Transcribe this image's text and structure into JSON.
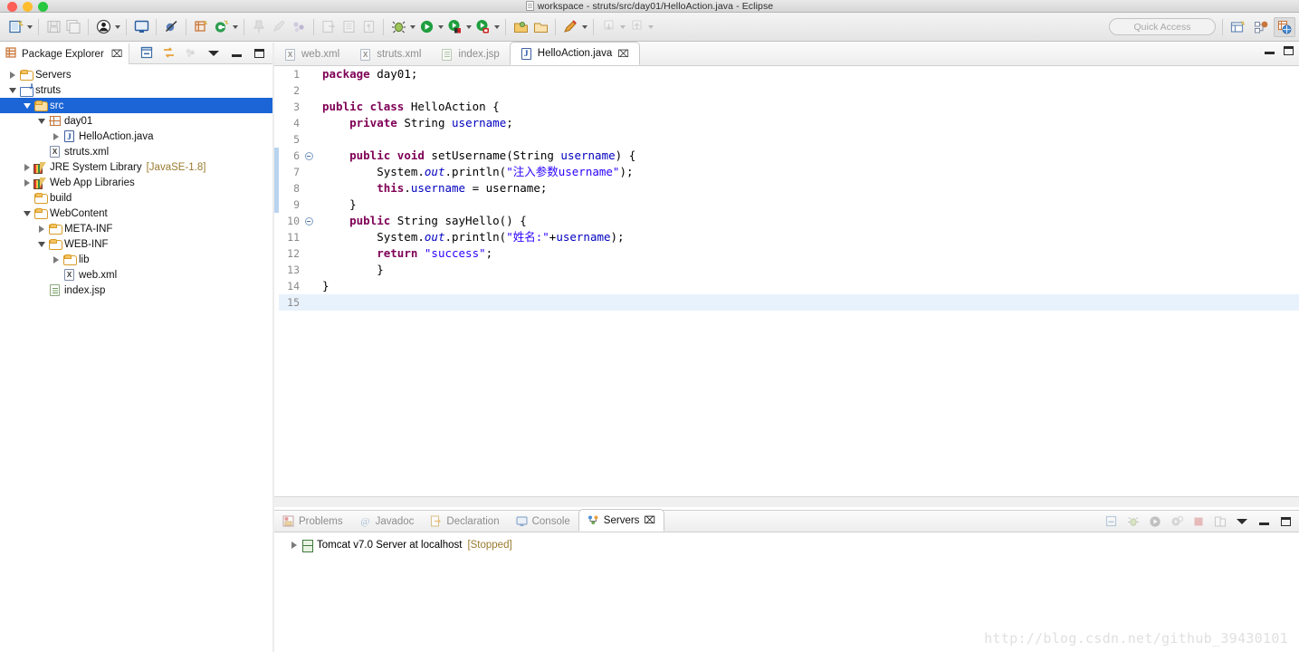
{
  "window": {
    "title": "workspace - struts/src/day01/HelloAction.java - Eclipse",
    "title_icon": "document-icon"
  },
  "toolbar": {
    "quick_access_placeholder": "Quick Access",
    "buttons": [
      {
        "name": "new-wizard",
        "icon": "new-file-icon",
        "dropdown": true,
        "enabled": true
      },
      {
        "name": "save",
        "icon": "save-icon",
        "dropdown": false,
        "enabled": false
      },
      {
        "name": "save-all",
        "icon": "save-all-icon",
        "dropdown": false,
        "enabled": false
      },
      {
        "name": "user",
        "icon": "user-icon",
        "dropdown": true,
        "enabled": true
      },
      {
        "name": "open-console",
        "icon": "console-icon",
        "dropdown": false,
        "enabled": true
      },
      {
        "name": "skip-breakpoints",
        "icon": "skip-breakpoints-icon",
        "dropdown": false,
        "enabled": true
      },
      {
        "name": "new-java-package",
        "icon": "package-icon",
        "dropdown": false,
        "enabled": true
      },
      {
        "name": "new-class",
        "icon": "new-class-icon",
        "dropdown": true,
        "enabled": true
      },
      {
        "name": "pin",
        "icon": "pin-icon",
        "dropdown": false,
        "enabled": false
      },
      {
        "name": "annotation",
        "icon": "annotation-icon",
        "dropdown": false,
        "enabled": false
      },
      {
        "name": "refactor",
        "icon": "refactor-icon",
        "dropdown": false,
        "enabled": false
      },
      {
        "name": "export",
        "icon": "export-icon",
        "dropdown": false,
        "enabled": false
      },
      {
        "name": "outline",
        "icon": "outline-icon",
        "dropdown": false,
        "enabled": false
      },
      {
        "name": "paragraph",
        "icon": "paragraph-icon",
        "dropdown": false,
        "enabled": false
      },
      {
        "name": "debug",
        "icon": "debug-icon",
        "dropdown": true,
        "enabled": true
      },
      {
        "name": "run",
        "icon": "run-icon",
        "dropdown": true,
        "enabled": true
      },
      {
        "name": "run-on-server",
        "icon": "run-server-icon",
        "dropdown": true,
        "enabled": true
      },
      {
        "name": "stop-server",
        "icon": "stop-server-icon",
        "dropdown": true,
        "enabled": true
      },
      {
        "name": "open-type",
        "icon": "open-type-icon",
        "dropdown": false,
        "enabled": true
      },
      {
        "name": "open-resource",
        "icon": "open-resource-icon",
        "dropdown": false,
        "enabled": true
      },
      {
        "name": "external-tools",
        "icon": "external-tools-icon",
        "dropdown": true,
        "enabled": true
      },
      {
        "name": "previous-annotation",
        "icon": "prev-annotation-icon",
        "dropdown": true,
        "enabled": false
      },
      {
        "name": "next-annotation",
        "icon": "next-annotation-icon",
        "dropdown": true,
        "enabled": false
      }
    ],
    "perspective": [
      {
        "name": "open-perspective",
        "icon": "open-perspective-icon"
      },
      {
        "name": "java-ee-perspective",
        "icon": "java-ee-perspective-icon"
      },
      {
        "name": "web-perspective",
        "icon": "web-perspective-icon",
        "active": true
      }
    ]
  },
  "explorer": {
    "tab_label": "Package Explorer",
    "close_glyph": "⌧",
    "tools": [
      {
        "name": "collapse-all-icon"
      },
      {
        "name": "link-with-editor-icon"
      },
      {
        "name": "focus-on-active-task-icon"
      }
    ],
    "view_menu": "view-menu-icon",
    "minimize": "minimize-icon",
    "maximize": "maximize-icon",
    "tree": [
      {
        "indent": 0,
        "twisty": "collapsed",
        "icon": "folder-icon",
        "label": "Servers",
        "suffix": "",
        "selected": false
      },
      {
        "indent": 0,
        "twisty": "expanded",
        "icon": "project-icon",
        "label": "struts",
        "suffix": "",
        "selected": false
      },
      {
        "indent": 1,
        "twisty": "expanded",
        "icon": "source-folder-icon",
        "label": "src",
        "suffix": "",
        "selected": true
      },
      {
        "indent": 2,
        "twisty": "expanded",
        "icon": "package-icon",
        "label": "day01",
        "suffix": "",
        "selected": false
      },
      {
        "indent": 3,
        "twisty": "collapsed",
        "icon": "java-file-icon",
        "label": "HelloAction.java",
        "suffix": "",
        "selected": false
      },
      {
        "indent": 2,
        "twisty": "none",
        "icon": "xml-file-icon",
        "label": "struts.xml",
        "suffix": "",
        "selected": false
      },
      {
        "indent": 1,
        "twisty": "collapsed",
        "icon": "library-icon",
        "label": "JRE System Library",
        "suffix": "[JavaSE-1.8]",
        "selected": false
      },
      {
        "indent": 1,
        "twisty": "collapsed",
        "icon": "library-icon",
        "label": "Web App Libraries",
        "suffix": "",
        "selected": false
      },
      {
        "indent": 1,
        "twisty": "none",
        "icon": "folder-icon",
        "label": "build",
        "suffix": "",
        "selected": false
      },
      {
        "indent": 1,
        "twisty": "expanded",
        "icon": "folder-icon",
        "label": "WebContent",
        "suffix": "",
        "selected": false
      },
      {
        "indent": 2,
        "twisty": "collapsed",
        "icon": "folder-icon",
        "label": "META-INF",
        "suffix": "",
        "selected": false
      },
      {
        "indent": 2,
        "twisty": "expanded",
        "icon": "folder-icon",
        "label": "WEB-INF",
        "suffix": "",
        "selected": false
      },
      {
        "indent": 3,
        "twisty": "collapsed",
        "icon": "folder-icon",
        "label": "lib",
        "suffix": "",
        "selected": false
      },
      {
        "indent": 3,
        "twisty": "none",
        "icon": "xml-file-icon",
        "label": "web.xml",
        "suffix": "",
        "selected": false
      },
      {
        "indent": 2,
        "twisty": "none",
        "icon": "jsp-file-icon",
        "label": "index.jsp",
        "suffix": "",
        "selected": false
      }
    ]
  },
  "editor": {
    "tabs": [
      {
        "label": "web.xml",
        "icon": "xml-file-icon",
        "active": false
      },
      {
        "label": "struts.xml",
        "icon": "xml-file-icon",
        "active": false
      },
      {
        "label": "index.jsp",
        "icon": "jsp-file-icon",
        "active": false
      },
      {
        "label": "HelloAction.java",
        "icon": "java-file-icon",
        "active": true
      }
    ],
    "close_glyph": "⌧",
    "minimize": "minimize-icon",
    "maximize": "maximize-icon",
    "current_line": 15,
    "change_marker_lines": [
      6,
      7,
      8,
      9
    ],
    "code": [
      {
        "n": 1,
        "fold": false,
        "tokens": [
          {
            "t": "package ",
            "c": "kw"
          },
          {
            "t": "day01;",
            "c": ""
          }
        ]
      },
      {
        "n": 2,
        "fold": false,
        "tokens": []
      },
      {
        "n": 3,
        "fold": false,
        "tokens": [
          {
            "t": "public class ",
            "c": "kw"
          },
          {
            "t": "HelloAction {",
            "c": ""
          }
        ]
      },
      {
        "n": 4,
        "fold": false,
        "tokens": [
          {
            "t": "    ",
            "c": ""
          },
          {
            "t": "private ",
            "c": "kw"
          },
          {
            "t": "String ",
            "c": ""
          },
          {
            "t": "username",
            "c": "fld"
          },
          {
            "t": ";",
            "c": ""
          }
        ]
      },
      {
        "n": 5,
        "fold": false,
        "tokens": []
      },
      {
        "n": 6,
        "fold": true,
        "tokens": [
          {
            "t": "    ",
            "c": ""
          },
          {
            "t": "public void ",
            "c": "kw"
          },
          {
            "t": "setUsername(String ",
            "c": ""
          },
          {
            "t": "username",
            "c": "fld"
          },
          {
            "t": ") {",
            "c": ""
          }
        ]
      },
      {
        "n": 7,
        "fold": false,
        "tokens": [
          {
            "t": "        System.",
            "c": ""
          },
          {
            "t": "out",
            "c": "stat"
          },
          {
            "t": ".println(",
            "c": ""
          },
          {
            "t": "\"注入参数username\"",
            "c": "str"
          },
          {
            "t": ");",
            "c": ""
          }
        ]
      },
      {
        "n": 8,
        "fold": false,
        "tokens": [
          {
            "t": "        ",
            "c": ""
          },
          {
            "t": "this",
            "c": "kw"
          },
          {
            "t": ".",
            "c": ""
          },
          {
            "t": "username",
            "c": "fld"
          },
          {
            "t": " = username;",
            "c": ""
          }
        ]
      },
      {
        "n": 9,
        "fold": false,
        "tokens": [
          {
            "t": "    }",
            "c": ""
          }
        ]
      },
      {
        "n": 10,
        "fold": true,
        "tokens": [
          {
            "t": "    ",
            "c": ""
          },
          {
            "t": "public ",
            "c": "kw"
          },
          {
            "t": "String sayHello() {",
            "c": ""
          }
        ]
      },
      {
        "n": 11,
        "fold": false,
        "tokens": [
          {
            "t": "        System.",
            "c": ""
          },
          {
            "t": "out",
            "c": "stat"
          },
          {
            "t": ".println(",
            "c": ""
          },
          {
            "t": "\"姓名:\"",
            "c": "str"
          },
          {
            "t": "+",
            "c": ""
          },
          {
            "t": "username",
            "c": "fld"
          },
          {
            "t": ");",
            "c": ""
          }
        ]
      },
      {
        "n": 12,
        "fold": false,
        "tokens": [
          {
            "t": "        ",
            "c": ""
          },
          {
            "t": "return ",
            "c": "kw"
          },
          {
            "t": "\"success\"",
            "c": "str"
          },
          {
            "t": ";",
            "c": ""
          }
        ]
      },
      {
        "n": 13,
        "fold": false,
        "tokens": [
          {
            "t": "        }",
            "c": ""
          }
        ]
      },
      {
        "n": 14,
        "fold": false,
        "tokens": [
          {
            "t": "}",
            "c": ""
          }
        ]
      },
      {
        "n": 15,
        "fold": false,
        "tokens": []
      }
    ]
  },
  "bottom_panel": {
    "tabs": [
      {
        "label": "Problems",
        "icon": "problems-icon",
        "active": false
      },
      {
        "label": "Javadoc",
        "icon": "javadoc-icon",
        "active": false
      },
      {
        "label": "Declaration",
        "icon": "declaration-icon",
        "active": false
      },
      {
        "label": "Console",
        "icon": "console-icon",
        "active": false
      },
      {
        "label": "Servers",
        "icon": "servers-icon",
        "active": true
      }
    ],
    "close_glyph": "⌧",
    "tools": [
      {
        "name": "collapse-all-icon"
      },
      {
        "name": "debug-server-icon"
      },
      {
        "name": "start-server-icon"
      },
      {
        "name": "start-profiling-icon"
      },
      {
        "name": "stop-server-icon"
      },
      {
        "name": "publish-icon"
      }
    ],
    "view_menu": "view-menu-icon",
    "minimize": "minimize-icon",
    "maximize": "maximize-icon",
    "servers": [
      {
        "icon": "tomcat-icon",
        "twisty": "collapsed",
        "label": "Tomcat v7.0 Server at localhost",
        "status": "[Stopped]"
      }
    ]
  },
  "watermark": {
    "text": "http://blog.csdn.net/github_39430101"
  },
  "colors": {
    "selection_blue": "#1b65d6",
    "keyword": "#7f0055",
    "string": "#2a00ff",
    "field": "#0000c0",
    "current_line": "#e8f2fc",
    "change_bar": "#b8d4f0",
    "suffix_text": "#9a7b2e"
  }
}
